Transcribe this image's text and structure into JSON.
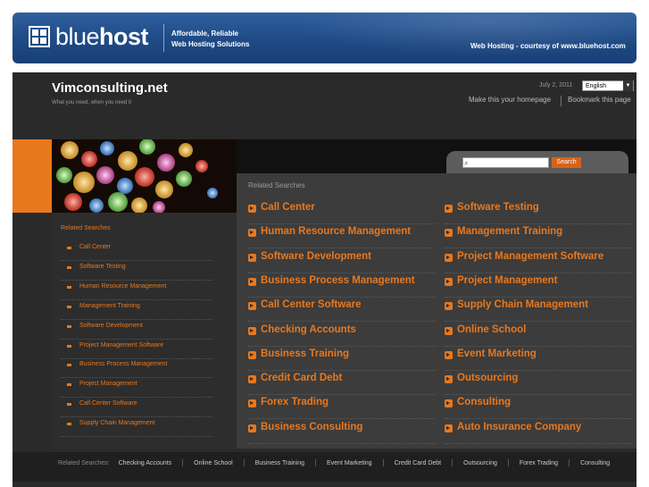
{
  "banner": {
    "brand_light": "blue",
    "brand_bold": "host",
    "tagline_line1": "Affordable, Reliable",
    "tagline_line2": "Web Hosting Solutions",
    "courtesy": "Web Hosting - courtesy of www.bluehost.com"
  },
  "site": {
    "title": "Vimconsulting.net",
    "tagline": "What you need, when you need it",
    "date": "July 2, 2011",
    "language": "English",
    "make_homepage": "Make this your homepage",
    "bookmark": "Bookmark this page"
  },
  "search": {
    "placeholder": "",
    "button": "Search"
  },
  "left_sidebar": {
    "heading": "Related Searches",
    "items": [
      "Call Center",
      "Software Testing",
      "Human Resource Management",
      "Management Training",
      "Software Development",
      "Project Management Software",
      "Business Process Management",
      "Project Management",
      "Call Center Software",
      "Supply Chain Management"
    ]
  },
  "main": {
    "heading": "Related Searches",
    "left_column": [
      "Call Center",
      "Human Resource Management",
      "Software Development",
      "Business Process Management",
      "Call Center Software",
      "Checking Accounts",
      "Business Training",
      "Credit Card Debt",
      "Forex Trading",
      "Business Consulting"
    ],
    "right_column": [
      "Software Testing",
      "Management Training",
      "Project Management Software",
      "Project Management",
      "Supply Chain Management",
      "Online School",
      "Event Marketing",
      "Outsourcing",
      "Consulting",
      "Auto Insurance Company"
    ]
  },
  "footer": {
    "label": "Related Searches:",
    "links": [
      "Checking Accounts",
      "Online School",
      "Business Training",
      "Event Marketing",
      "Credit Card Debt",
      "Outsourcing",
      "Forex Trading",
      "Consulting"
    ]
  },
  "colors": {
    "accent": "#e8781e",
    "banner_blue": "#1f4a85",
    "background": "#2a2a2a"
  }
}
